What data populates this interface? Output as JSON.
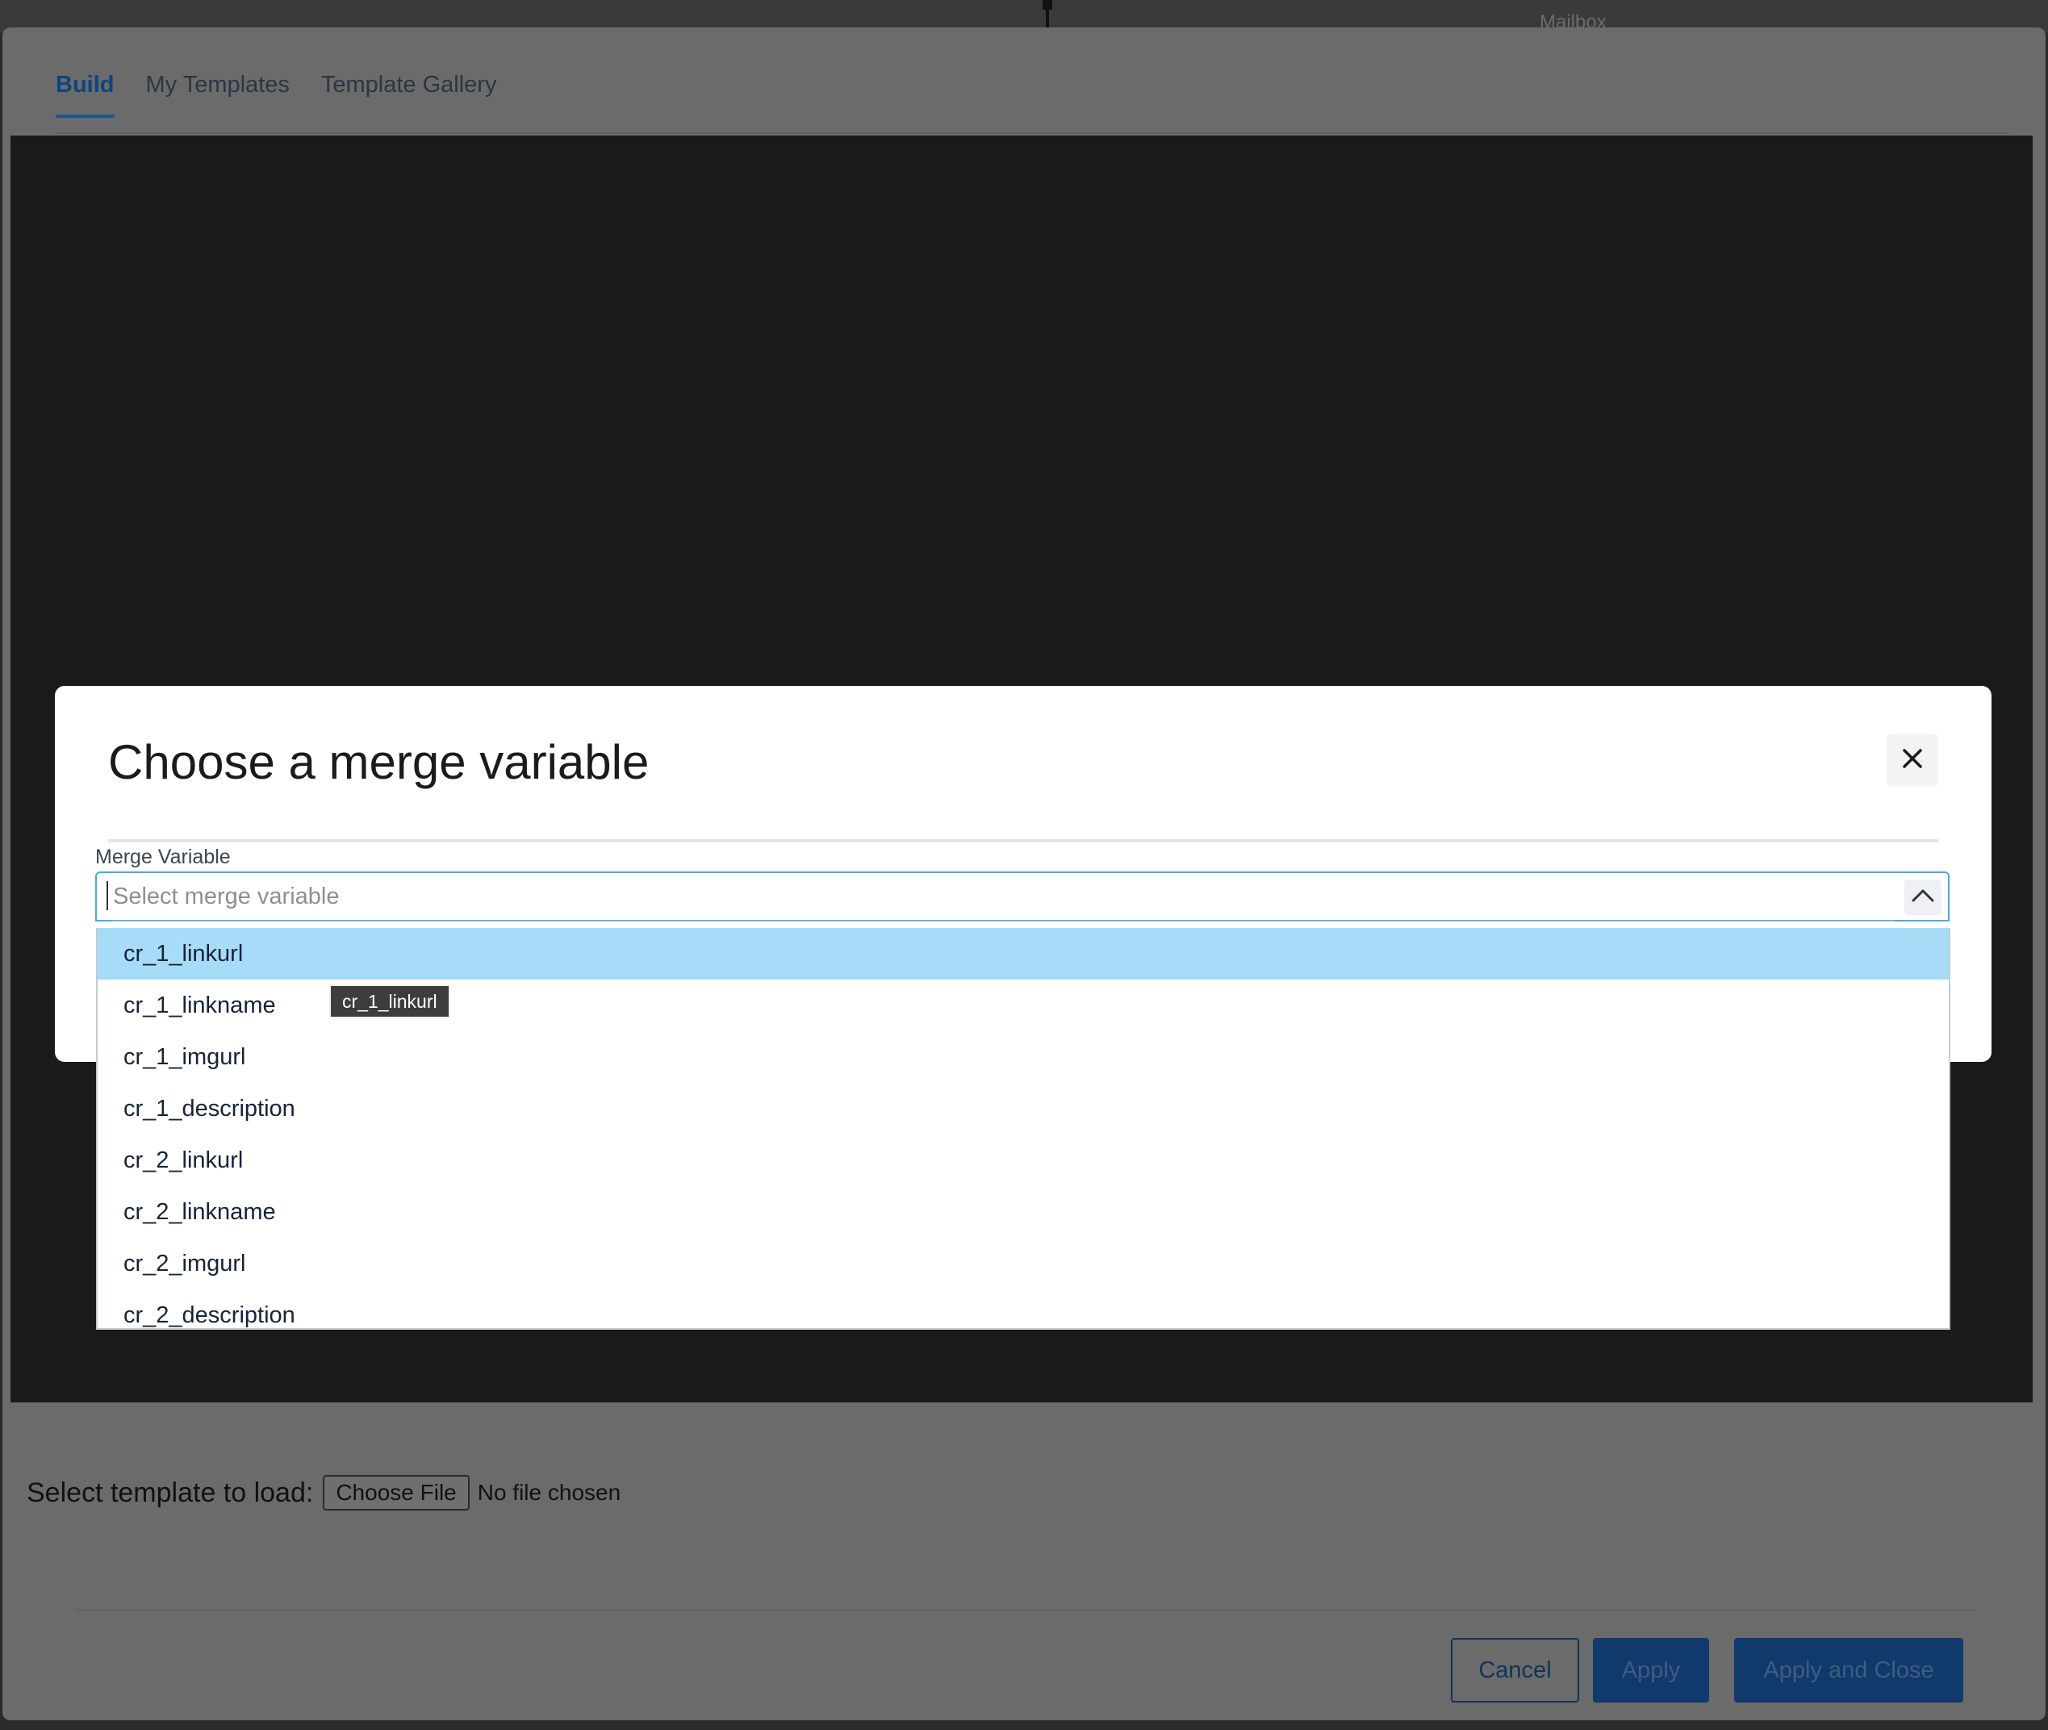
{
  "background": {
    "mailbox_label": "Mailbox"
  },
  "editor": {
    "tabs": [
      {
        "label": "Build",
        "active": true
      },
      {
        "label": "My Templates",
        "active": false
      },
      {
        "label": "Template Gallery",
        "active": false
      }
    ],
    "load_template_label": "Select template to load:",
    "choose_file_label": "Choose File",
    "no_file_label": "No file chosen",
    "buttons": {
      "cancel": "Cancel",
      "apply": "Apply",
      "apply_close": "Apply and Close"
    }
  },
  "modal": {
    "title": "Choose a merge variable",
    "close_icon": "close-icon",
    "field_label": "Merge Variable",
    "placeholder": "Select merge variable",
    "chevron_icon": "chevron-up-icon",
    "options": [
      "cr_1_linkurl",
      "cr_1_linkname",
      "cr_1_imgurl",
      "cr_1_description",
      "cr_2_linkurl",
      "cr_2_linkname",
      "cr_2_imgurl",
      "cr_2_description"
    ],
    "highlighted_index": 0,
    "tooltip": "cr_1_linkurl"
  },
  "colors": {
    "accent": "#1b5594",
    "option_highlight": "#a7dcf9",
    "focus_border": "#4aa8e6"
  }
}
